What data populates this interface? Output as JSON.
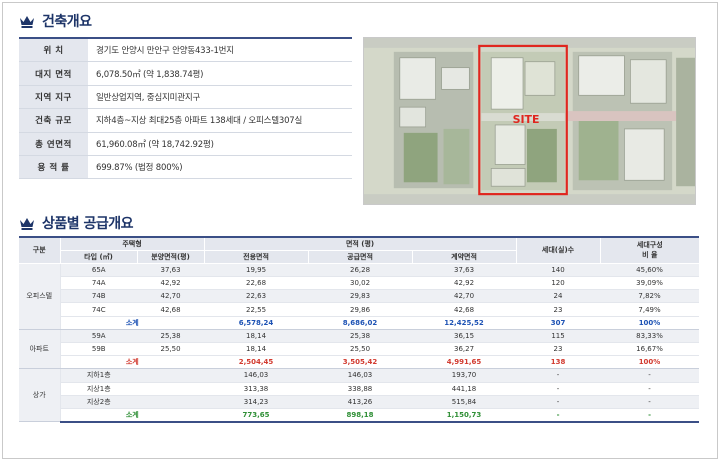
{
  "overview": {
    "title": "건축개요",
    "rows": [
      {
        "label": "위        치",
        "value": "경기도 안양시 만안구 안양동433-1번지"
      },
      {
        "label": "대지 면적",
        "value": "6,078.50㎡ (약 1,838.74평)"
      },
      {
        "label": "지역 지구",
        "value": "일반상업지역, 중심지미관지구"
      },
      {
        "label": "건축 규모",
        "value": "지하4층~지상 최대25층 아파트 138세대 / 오피스텔307실"
      },
      {
        "label": "총 연면적",
        "value": "61,960.08㎡ (약 18,742.92평)"
      },
      {
        "label": "용  적  률",
        "value": "699.87% (법정 800%)"
      }
    ]
  },
  "site_plan": {
    "label": "SITE",
    "accent": "#e0261f"
  },
  "supply": {
    "title": "상품별 공급개요",
    "headers": {
      "category": "구분",
      "housing_type": "주택형",
      "type": "타입 (㎡)",
      "sale_area": "분양면적(평)",
      "area": "면적 (평)",
      "exclusive": "전용면적",
      "common": "공급면적",
      "contract": "계약면적",
      "units": "세대(실)수",
      "ratio_line1": "세대구성",
      "ratio_line2": "비        율"
    },
    "groups": [
      {
        "name": "오피스텔",
        "rows": [
          {
            "type": "65A",
            "sale": "37,63",
            "excl": "19,95",
            "supply": "26,28",
            "contract": "37,63",
            "units": "140",
            "ratio": "45,60%"
          },
          {
            "type": "74A",
            "sale": "42,92",
            "excl": "22,68",
            "supply": "30,02",
            "contract": "42,92",
            "units": "120",
            "ratio": "39,09%"
          },
          {
            "type": "74B",
            "sale": "42,70",
            "excl": "22,63",
            "supply": "29,83",
            "contract": "42,70",
            "units": "24",
            "ratio": "7,82%"
          },
          {
            "type": "74C",
            "sale": "42,68",
            "excl": "22,55",
            "supply": "29,86",
            "contract": "42,68",
            "units": "23",
            "ratio": "7,49%"
          }
        ],
        "subtotal": {
          "label": "소계",
          "excl": "6,578,24",
          "supply": "8,686,02",
          "contract": "12,425,52",
          "units": "307",
          "ratio": "100%"
        }
      },
      {
        "name": "아파트",
        "rows": [
          {
            "type": "59A",
            "sale": "25,38",
            "excl": "18,14",
            "supply": "25,38",
            "contract": "36,15",
            "units": "115",
            "ratio": "83,33%"
          },
          {
            "type": "59B",
            "sale": "25,50",
            "excl": "18,14",
            "supply": "25,50",
            "contract": "36,27",
            "units": "23",
            "ratio": "16,67%"
          }
        ],
        "subtotal": {
          "label": "소계",
          "excl": "2,504,45",
          "supply": "3,505,42",
          "contract": "4,991,65",
          "units": "138",
          "ratio": "100%"
        }
      },
      {
        "name": "상가",
        "rows": [
          {
            "type": "지하1층",
            "sale": "",
            "excl": "146,03",
            "supply": "146,03",
            "contract": "193,70",
            "units": "-",
            "ratio": "-"
          },
          {
            "type": "지상1층",
            "sale": "",
            "excl": "313,38",
            "supply": "338,88",
            "contract": "441,18",
            "units": "-",
            "ratio": "-"
          },
          {
            "type": "지상2층",
            "sale": "",
            "excl": "314,23",
            "supply": "413,26",
            "contract": "515,84",
            "units": "-",
            "ratio": "-"
          }
        ],
        "subtotal": {
          "label": "소계",
          "excl": "773,65",
          "supply": "898,18",
          "contract": "1,150,73",
          "units": "-",
          "ratio": "-"
        }
      }
    ]
  }
}
